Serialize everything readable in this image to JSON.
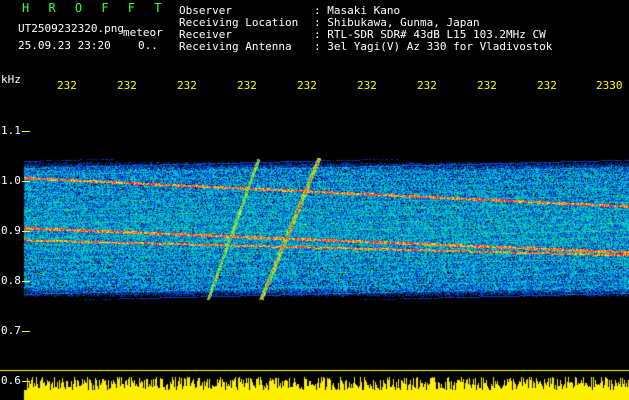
{
  "app": {
    "title": "H R O F F T",
    "filename": "UT2509232320.png",
    "mode": "meteor",
    "datetime": "25.09.23 23:20",
    "counter": "0.."
  },
  "info": {
    "labels": [
      "Observer",
      "Receiving Location",
      "Receiver",
      "Receiving Antenna"
    ],
    "values": [
      ": Masaki Kano",
      ": Shibukawa, Gunma, Japan",
      ": RTL-SDR SDR# 43dB L15 103.2MHz CW",
      ": 3el Yagi(V) Az 330 for Vladivostok"
    ]
  },
  "axes": {
    "y_unit": "kHz",
    "y_ticks": [
      "1.1",
      "1.0",
      "0.9",
      "0.8",
      "0.7",
      "0.6"
    ],
    "x_ticks": [
      "232",
      "232",
      "232",
      "232",
      "232",
      "232",
      "232",
      "232",
      "232",
      "2330"
    ]
  },
  "colors": {
    "background": "#000000",
    "tick": "#ffff00",
    "title": "#33ff33",
    "noise_floor": "#ffff00"
  }
}
